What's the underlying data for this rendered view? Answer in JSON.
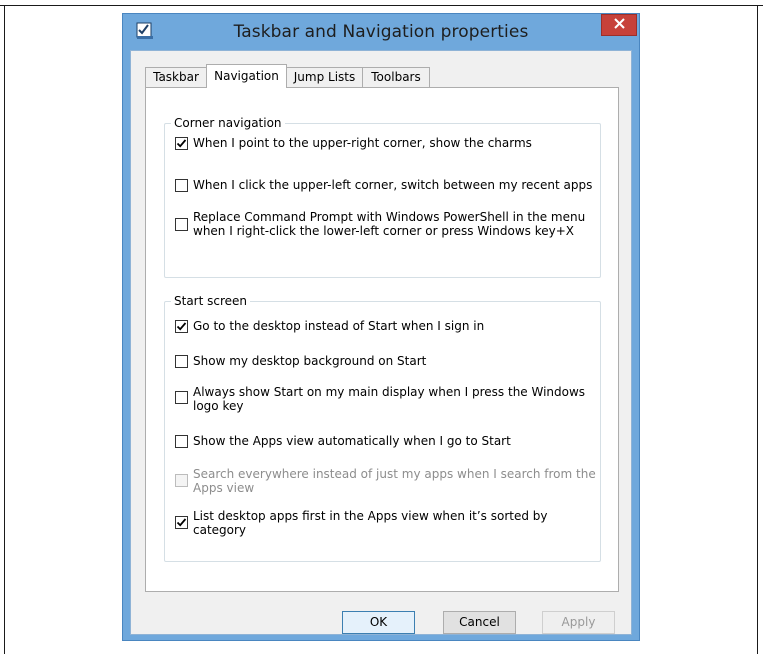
{
  "window": {
    "title": "Taskbar and Navigation properties"
  },
  "tabs": [
    {
      "label": "Taskbar",
      "active": false
    },
    {
      "label": "Navigation",
      "active": true
    },
    {
      "label": "Jump Lists",
      "active": false
    },
    {
      "label": "Toolbars",
      "active": false
    }
  ],
  "corner_navigation": {
    "heading": "Corner navigation",
    "options": [
      {
        "label": "When I point to the upper-right corner, show the charms",
        "checked": true,
        "enabled": true
      },
      {
        "label": "When I click the upper-left corner, switch between my recent apps",
        "checked": false,
        "enabled": true
      },
      {
        "label": "Replace Command Prompt with Windows PowerShell in the menu when I right-click the lower-left corner or press Windows key+X",
        "checked": false,
        "enabled": true
      }
    ]
  },
  "start_screen": {
    "heading": "Start screen",
    "options": [
      {
        "label": "Go to the desktop instead of Start when I sign in",
        "checked": true,
        "enabled": true
      },
      {
        "label": "Show my desktop background on Start",
        "checked": false,
        "enabled": true
      },
      {
        "label": "Always show Start on my main display when I press the Windows logo key",
        "checked": false,
        "enabled": true
      },
      {
        "label": "Show the Apps view automatically when I go to Start",
        "checked": false,
        "enabled": true
      },
      {
        "label": "Search everywhere instead of just my apps when I search from the Apps view",
        "checked": false,
        "enabled": false
      },
      {
        "label": "List desktop apps first in the Apps view when it’s sorted by category",
        "checked": true,
        "enabled": true
      }
    ]
  },
  "buttons": {
    "ok": "OK",
    "cancel": "Cancel",
    "apply": "Apply"
  }
}
